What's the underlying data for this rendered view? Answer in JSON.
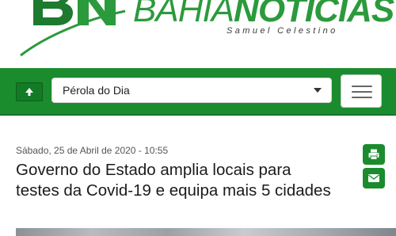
{
  "header": {
    "brand_part1": "BAHIA",
    "brand_part2": "NOTÍCIAS",
    "tagline": "Samuel Celestino",
    "logo_icon": "bn-logo",
    "brand_color": "#2b9a3c"
  },
  "navbar": {
    "up_icon": "arrow-up-icon",
    "section_selected": "Pérola do Dia",
    "menu_icon": "hamburger-icon",
    "bar_color": "#1a8c2e"
  },
  "article": {
    "date": "Sábado, 25 de Abril de 2020 - 10:55",
    "headline": "Governo do Estado amplia locais para testes da Covid-19 e equipa mais 5 cidades",
    "print_icon": "printer-icon",
    "email_icon": "envelope-icon"
  }
}
